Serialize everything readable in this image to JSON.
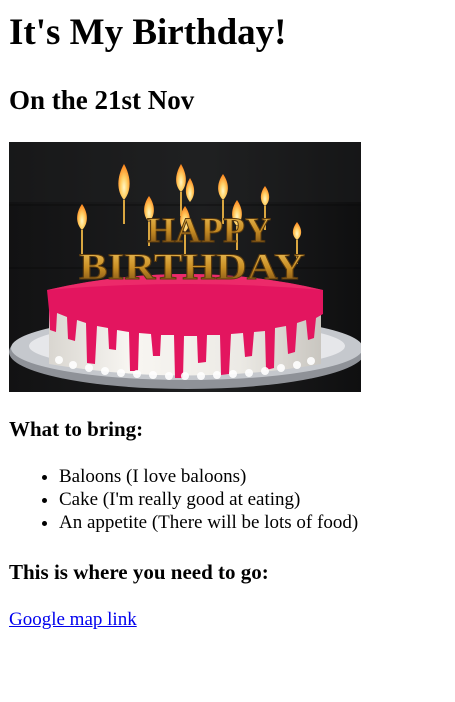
{
  "page": {
    "title": "It's My Birthday!",
    "subtitle": "On the 21st Nov"
  },
  "hero_image": {
    "cake_lettering": {
      "top": "HAPPY",
      "bottom": "BIRTHDAY"
    },
    "colors": {
      "background": "#151516",
      "icing": "#f5f3ef",
      "drip": "#e3155f",
      "plate": "#b9bcc2",
      "gold": "#cf9a2b",
      "flame": "#ffd36a"
    }
  },
  "sections": {
    "bring": {
      "heading": "What to bring:",
      "items": [
        "Baloons (I love baloons)",
        "Cake (I'm really good at eating)",
        "An appetite (There will be lots of food)"
      ]
    },
    "location": {
      "heading": "This is where you need to go:",
      "link_text": "Google map link"
    }
  }
}
